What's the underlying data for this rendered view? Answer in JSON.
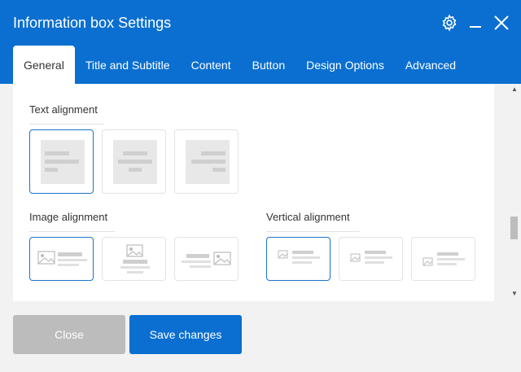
{
  "window": {
    "title": "Information box Settings",
    "icons": [
      "gear-icon",
      "minimize-icon",
      "close-icon"
    ],
    "accent": "#0a6fd1"
  },
  "tabs": [
    {
      "label": "General",
      "active": true
    },
    {
      "label": "Title and Subtitle",
      "active": false
    },
    {
      "label": "Content",
      "active": false
    },
    {
      "label": "Button",
      "active": false
    },
    {
      "label": "Design Options",
      "active": false
    },
    {
      "label": "Advanced",
      "active": false
    }
  ],
  "text_alignment": {
    "label": "Text alignment",
    "options": [
      "left",
      "center",
      "right"
    ],
    "selected": "left"
  },
  "image_alignment": {
    "label": "Image alignment",
    "options": [
      "left",
      "top",
      "right"
    ],
    "selected": "left"
  },
  "vertical_alignment": {
    "label": "Vertical alignment",
    "options": [
      "top",
      "middle",
      "bottom"
    ],
    "selected": "top"
  },
  "footer": {
    "close_label": "Close",
    "save_label": "Save changes"
  }
}
